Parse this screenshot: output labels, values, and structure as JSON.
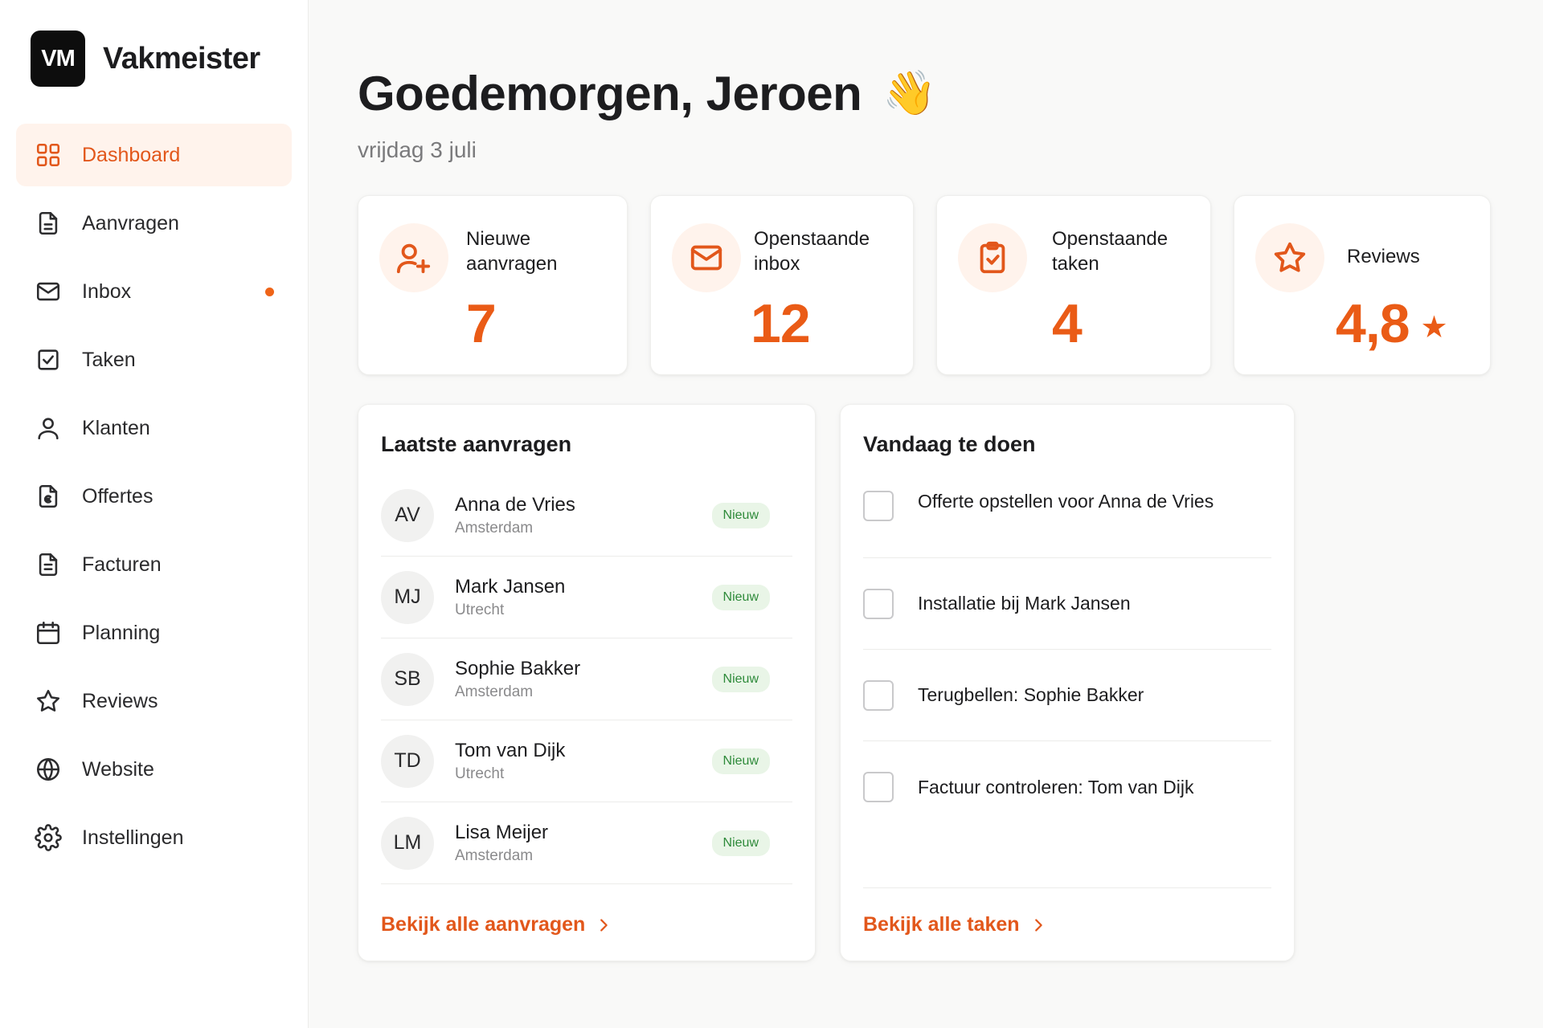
{
  "brand": {
    "logo": "VM",
    "name": "Vakmeister"
  },
  "nav": [
    {
      "label": "Dashboard",
      "icon": "grid-icon",
      "active": true
    },
    {
      "label": "Aanvragen",
      "icon": "document-icon"
    },
    {
      "label": "Inbox",
      "icon": "mail-icon",
      "dot": true
    },
    {
      "label": "Taken",
      "icon": "checkbox-icon"
    },
    {
      "label": "Klanten",
      "icon": "user-icon"
    },
    {
      "label": "Offertes",
      "icon": "euro-document-icon"
    },
    {
      "label": "Facturen",
      "icon": "invoice-icon"
    },
    {
      "label": "Planning",
      "icon": "calendar-icon"
    },
    {
      "label": "Reviews",
      "icon": "star-icon"
    },
    {
      "label": "Website",
      "icon": "globe-icon"
    },
    {
      "label": "Instellingen",
      "icon": "gear-icon"
    }
  ],
  "header": {
    "greeting": "Goedemorgen, Jeroen",
    "wave": "👋",
    "date": "vrijdag 3 juli"
  },
  "stats": [
    {
      "label": "Nieuwe\naanvragen",
      "value": "7",
      "icon": "user-plus-icon"
    },
    {
      "label": "Openstaande\ninbox",
      "value": "12",
      "icon": "mail-icon"
    },
    {
      "label": "Openstaande\ntaken",
      "value": "4",
      "icon": "clipboard-check-icon"
    },
    {
      "label": "Reviews",
      "value": "4,8",
      "star": "★",
      "icon": "star-icon"
    }
  ],
  "requests": {
    "title": "Laatste aanvragen",
    "items": [
      {
        "initials": "AV",
        "name": "Anna de Vries",
        "city": "Amsterdam",
        "badge": "Nieuw"
      },
      {
        "initials": "MJ",
        "name": "Mark Jansen",
        "city": "Utrecht",
        "badge": "Nieuw"
      },
      {
        "initials": "SB",
        "name": "Sophie Bakker",
        "city": "Amsterdam",
        "badge": "Nieuw"
      },
      {
        "initials": "TD",
        "name": "Tom van Dijk",
        "city": "Utrecht",
        "badge": "Nieuw"
      },
      {
        "initials": "LM",
        "name": "Lisa Meijer",
        "city": "Amsterdam",
        "badge": "Nieuw"
      }
    ],
    "link": "Bekijk alle aanvragen"
  },
  "todos": {
    "title": "Vandaag te doen",
    "items": [
      {
        "label": "Offerte opstellen voor Anna de Vries"
      },
      {
        "label": "Installatie bij Mark Jansen"
      },
      {
        "label": "Terugbellen: Sophie Bakker"
      },
      {
        "label": "Factuur controleren: Tom van Dijk"
      }
    ],
    "link": "Bekijk alle taken"
  },
  "colors": {
    "accent": "#e2571b",
    "accent_soft": "#fff3ec",
    "badge_bg": "#e9f5e7",
    "badge_text": "#2e8a3a"
  }
}
